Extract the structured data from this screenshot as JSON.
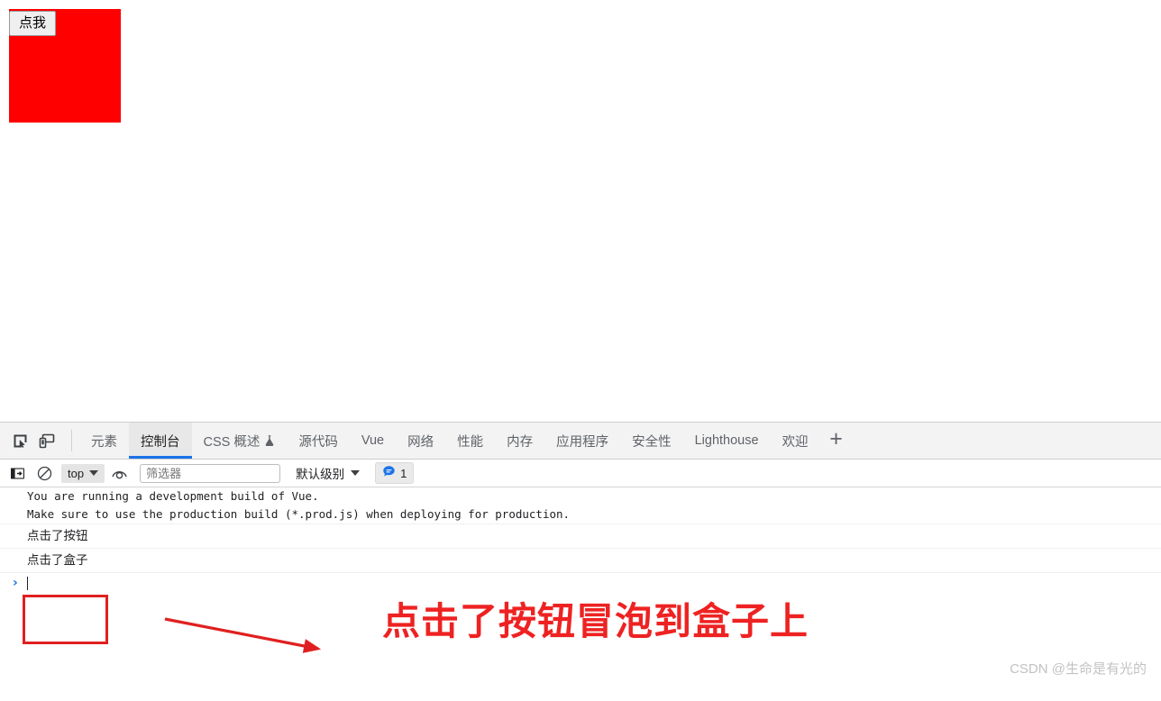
{
  "page": {
    "button_label": "点我",
    "box_color": "#ff0000",
    "button_bg": "#efefef"
  },
  "devtools": {
    "left_icons": [
      {
        "name": "inspect-element-icon",
        "title": "检查元素"
      },
      {
        "name": "device-toolbar-icon",
        "title": "切换设备工具栏"
      }
    ],
    "tabs": [
      {
        "label": "元素",
        "active": false,
        "flask": false
      },
      {
        "label": "控制台",
        "active": true,
        "flask": false
      },
      {
        "label": "CSS 概述",
        "active": false,
        "flask": true
      },
      {
        "label": "源代码",
        "active": false,
        "flask": false
      },
      {
        "label": "Vue",
        "active": false,
        "flask": false
      },
      {
        "label": "网络",
        "active": false,
        "flask": false
      },
      {
        "label": "性能",
        "active": false,
        "flask": false
      },
      {
        "label": "内存",
        "active": false,
        "flask": false
      },
      {
        "label": "应用程序",
        "active": false,
        "flask": false
      },
      {
        "label": "安全性",
        "active": false,
        "flask": false
      },
      {
        "label": "Lighthouse",
        "active": false,
        "flask": false
      },
      {
        "label": "欢迎",
        "active": false,
        "flask": false
      }
    ],
    "add_tab_label": "+",
    "active_tab_accent": "#1a73e8"
  },
  "console_toolbar": {
    "sidebar_toggle": "show-console-sidebar",
    "clear_console": "clear-console",
    "context": "top",
    "eye_icon": "create-live-expression",
    "filter_placeholder": "筛选器",
    "filter_value": "",
    "level": "默认级别",
    "issues_count": "1",
    "issues_icon_color": "#1a73e8"
  },
  "console_messages": [
    {
      "text": "You are running a development build of Vue.",
      "type": "mono"
    },
    {
      "text": "Make sure to use the production build (*.prod.js) when deploying for production.",
      "type": "mono"
    },
    {
      "text": "点击了按钮",
      "type": "cjk"
    },
    {
      "text": "点击了盒子",
      "type": "cjk"
    }
  ],
  "console_prompt": {
    "caret": "›",
    "value": ""
  },
  "annotations": {
    "callout_text": "点击了按钮冒泡到盒子上",
    "callout_color": "#ee2222",
    "box_color": "#e02020",
    "arrow_color": "#e02020"
  },
  "watermark": {
    "text": "CSDN @生命是有光的"
  }
}
